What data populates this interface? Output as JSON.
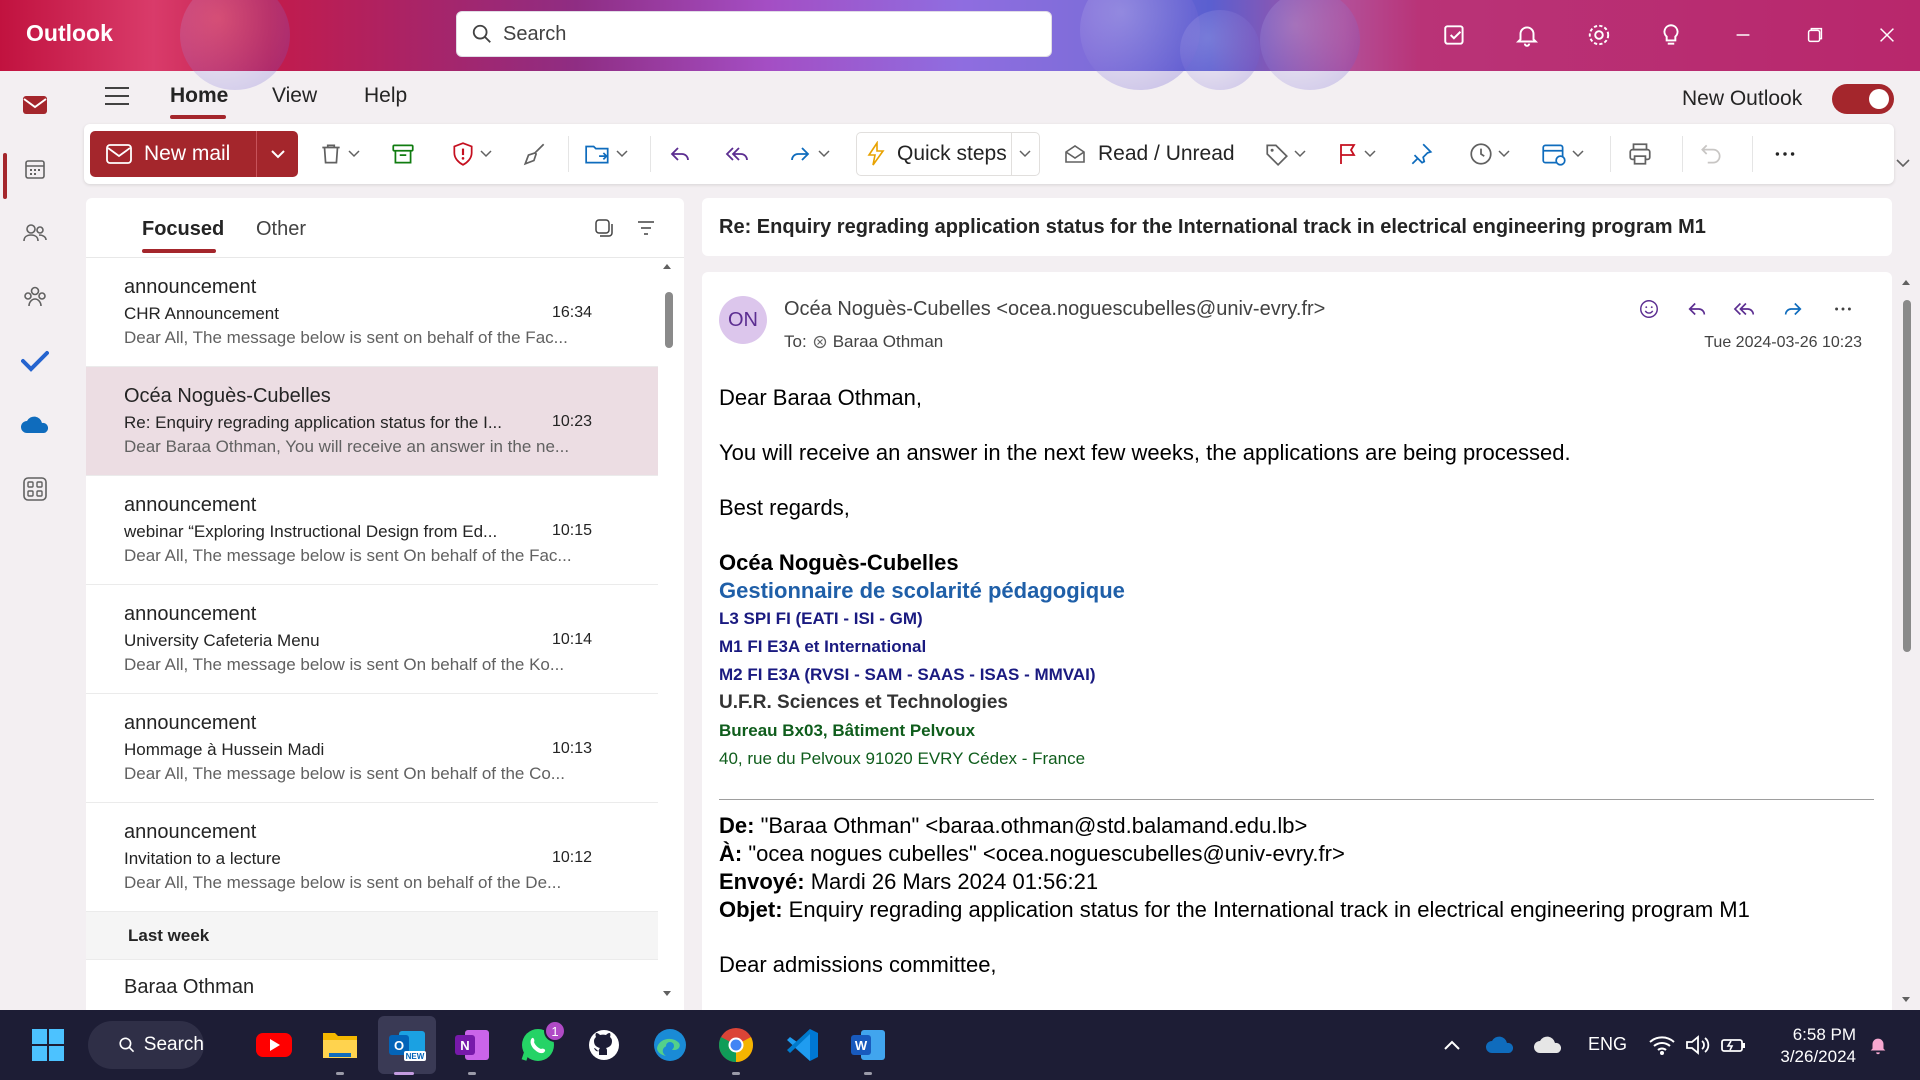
{
  "app": {
    "name": "Outlook"
  },
  "search": {
    "placeholder": "Search"
  },
  "menu": {
    "tabs": [
      "Home",
      "View",
      "Help"
    ],
    "active": "Home",
    "new_outlook_label": "New Outlook",
    "new_outlook_enabled": true
  },
  "ribbon": {
    "new_mail": "New mail",
    "quick_steps": "Quick steps",
    "read_unread": "Read / Unread"
  },
  "list": {
    "tabs": {
      "focused": "Focused",
      "other": "Other"
    },
    "items": [
      {
        "sender": "announcement",
        "subject": "CHR Announcement",
        "time": "16:34",
        "preview": "Dear All, The message below is sent on behalf of the Fac...",
        "selected": false
      },
      {
        "sender": "Océa Noguès-Cubelles",
        "subject": "Re: Enquiry regrading application status for the I...",
        "time": "10:23",
        "preview": "Dear Baraa Othman, You will receive an answer in the ne...",
        "selected": true
      },
      {
        "sender": "announcement",
        "subject": "webinar “Exploring Instructional Design from Ed...",
        "time": "10:15",
        "preview": "Dear All, The message below is sent On behalf of the Fac...",
        "selected": false
      },
      {
        "sender": "announcement",
        "subject": "University Cafeteria Menu",
        "time": "10:14",
        "preview": "Dear All, The message below is sent On behalf of the Ko...",
        "selected": false
      },
      {
        "sender": "announcement",
        "subject": "Hommage à Hussein Madi",
        "time": "10:13",
        "preview": "Dear All, The message below is sent On behalf of the Co...",
        "selected": false
      },
      {
        "sender": "announcement",
        "subject": "Invitation to a lecture",
        "time": "10:12",
        "preview": "Dear All, The message below is sent on behalf of the De...",
        "selected": false
      }
    ],
    "group_header": "Last week",
    "partial_sender": "Baraa Othman"
  },
  "reading": {
    "subject": "Re: Enquiry regrading application status for the International track in electrical engineering program M1",
    "avatar_initials": "ON",
    "from": "Océa Noguès-Cubelles <ocea.noguescubelles@univ-evry.fr>",
    "to_label": "To:",
    "to_name": "Baraa Othman",
    "date": "Tue 2024-03-26 10:23",
    "body": {
      "greeting": "Dear Baraa Othman,",
      "message": "You will receive an answer in the next few weeks, the applications are being processed.",
      "closing": "Best regards,",
      "sig_name": "Océa Noguès-Cubelles",
      "sig_title": "Gestionnaire de scolarité pédagogique",
      "sig_line1": "L3 SPI FI (EATI - ISI - GM)",
      "sig_line2": "M1 FI E3A et International",
      "sig_line3": "M2 FI E3A (RVSI - SAM - SAAS - ISAS - MMVAI)",
      "sig_ufr": "U.F.R. Sciences et Technologies",
      "sig_bureau": "Bureau Bx03, Bâtiment  Pelvoux",
      "sig_address": "40, rue du Pelvoux 91020 EVRY Cédex - France"
    },
    "quoted": {
      "de_label": "De:",
      "de_value": " \"Baraa Othman\" <baraa.othman@std.balamand.edu.lb>",
      "a_label": "À:",
      "a_value": " \"ocea nogues cubelles\" <ocea.noguescubelles@univ-evry.fr>",
      "envoye_label": "Envoyé:",
      "envoye_value": " Mardi 26 Mars 2024 01:56:21",
      "objet_label": "Objet:",
      "objet_value": " Enquiry regrading application status for the International track in electrical engineering program M1",
      "opening": "Dear admissions committee,"
    }
  },
  "taskbar": {
    "search_label": "Search",
    "language": "ENG",
    "time": "6:58 PM",
    "date": "3/26/2024",
    "whatsapp_badge": "1"
  },
  "colors": {
    "accent": "#a4262c",
    "selected_item": "#ecdde3",
    "taskbar": "#1d1d35"
  }
}
